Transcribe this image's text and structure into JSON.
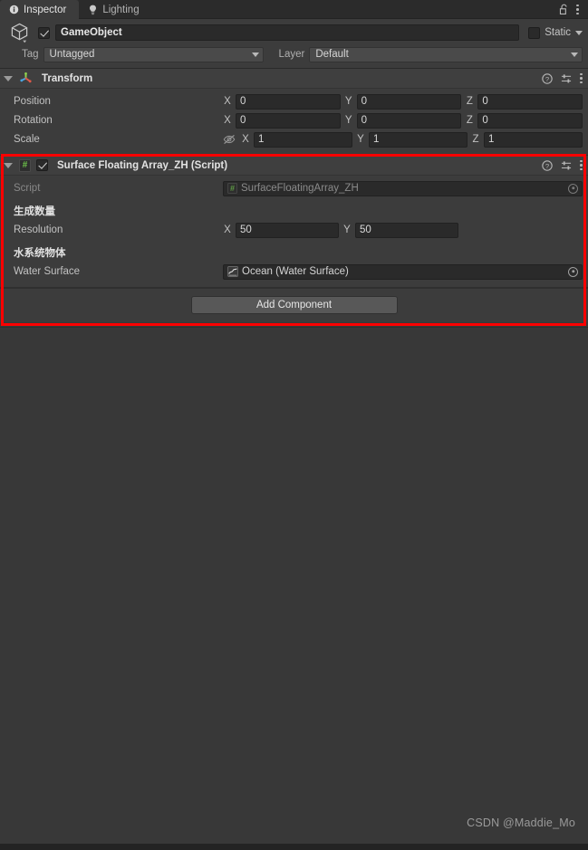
{
  "window": {
    "tabs": [
      {
        "label": "Inspector",
        "icon": "info-icon",
        "active": true
      },
      {
        "label": "Lighting",
        "icon": "lightbulb-icon",
        "active": false
      }
    ],
    "lock_icon": "lock-open-icon",
    "menu_icon": "kebab-menu-icon"
  },
  "gameobject": {
    "icon": "cube-icon",
    "enabled": true,
    "name": "GameObject",
    "static_label": "Static",
    "static_checked": false,
    "tag_label": "Tag",
    "tag_value": "Untagged",
    "layer_label": "Layer",
    "layer_value": "Default"
  },
  "components": [
    {
      "id": "transform",
      "title": "Transform",
      "icon": "transform-axis-icon",
      "help_icon": "help-icon",
      "preset_icon": "preset-sliders-icon",
      "menu_icon": "kebab-menu-icon",
      "rows": [
        {
          "label": "Position",
          "x": "0",
          "y": "0",
          "z": "0"
        },
        {
          "label": "Rotation",
          "x": "0",
          "y": "0",
          "z": "0"
        },
        {
          "label": "Scale",
          "x": "1",
          "y": "1",
          "z": "1",
          "constrain_icon": "eye-slash-icon"
        }
      ],
      "axis_labels": {
        "x": "X",
        "y": "Y",
        "z": "Z"
      }
    },
    {
      "id": "surface-floating-array-zh",
      "title": "Surface Floating Array_ZH (Script)",
      "icon": "cs-script-icon",
      "enabled": true,
      "help_icon": "help-icon",
      "preset_icon": "preset-sliders-icon",
      "menu_icon": "kebab-menu-icon",
      "script_row": {
        "label": "Script",
        "value": "SurfaceFloatingArray_ZH",
        "icon": "cs-script-asset-icon",
        "picker_icon": "object-picker-icon"
      },
      "resolution_section": {
        "header": "生成数量",
        "label": "Resolution",
        "x_label": "X",
        "x_value": "50",
        "y_label": "Y",
        "y_value": "50"
      },
      "water_section": {
        "header": "水系统物体",
        "label": "Water Surface",
        "value": "Ocean (Water Surface)",
        "icon": "water-surface-icon",
        "picker_icon": "object-picker-icon"
      }
    }
  ],
  "add_component": {
    "label": "Add Component"
  },
  "annotation": {
    "highlight_color": "#fe0000"
  },
  "watermark": {
    "text": "CSDN @Maddie_Mo"
  }
}
